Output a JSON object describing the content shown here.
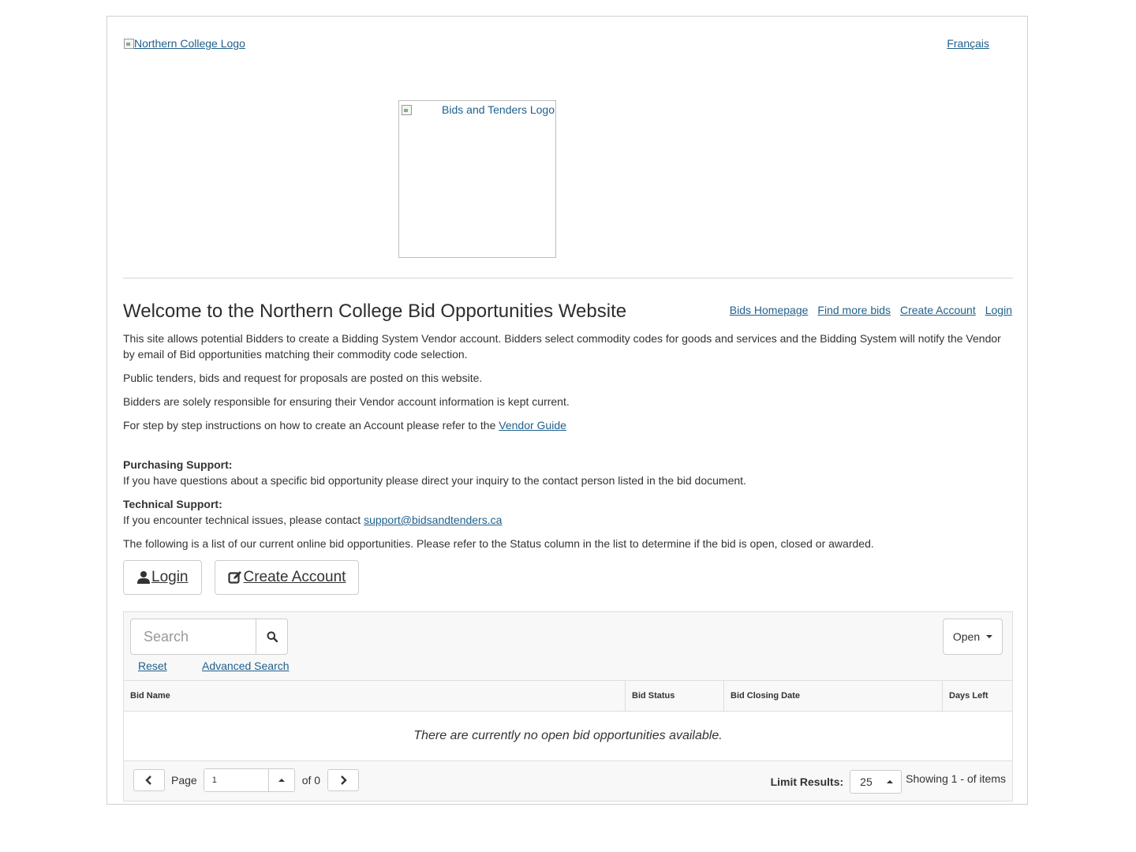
{
  "header": {
    "college_logo_alt": "Northern College Logo",
    "language_link": "Français",
    "tender_logo_alt": "Bids and Tenders Logo"
  },
  "welcome": {
    "title": "Welcome to the Northern College Bid Opportunities Website",
    "nav_links": [
      "Bids Homepage",
      "Find more bids",
      "Create Account",
      "Login"
    ]
  },
  "content": {
    "p1": "This site allows potential Bidders to create a Bidding System Vendor account.  Bidders select commodity codes for goods and services and the Bidding System will notify the Vendor by email of Bid opportunities matching their commodity code selection.",
    "p2": "Public tenders, bids and request for proposals are posted on this website.",
    "p3": "Bidders are solely responsible for ensuring their Vendor account information is kept current.",
    "p4_prefix": "For step by step instructions on how to create an Account please refer to the ",
    "p4_link": "Vendor Guide",
    "purchasing_heading": "Purchasing Support:",
    "purchasing_text": "If you have questions about a specific bid opportunity please direct your inquiry to the contact person listed in the bid document.",
    "technical_heading": "Technical Support:",
    "technical_prefix": "If you encounter technical issues, please contact ",
    "technical_email": "support@bidsandtenders.ca",
    "list_intro": "The following is a list of our current online bid opportunities. Please refer to the Status column in the list to determine if the bid is open, closed or awarded."
  },
  "actions": {
    "login_label": "Login",
    "create_account_label": "Create Account"
  },
  "search": {
    "placeholder": "Search",
    "reset_label": "Reset",
    "advanced_label": "Advanced Search",
    "status_filter": "Open"
  },
  "table": {
    "columns": [
      "Bid Name",
      "Bid Status",
      "Bid Closing Date",
      "Days Left"
    ],
    "empty_message": "There are currently no open bid opportunities available."
  },
  "pagination": {
    "page_label": "Page",
    "page_value": "1",
    "of_label": "of 0",
    "limit_label": "Limit Results:",
    "limit_value": "25",
    "showing": "Showing 1 - of items"
  },
  "colors": {
    "link": "#1f5f8b",
    "border": "#cccccc",
    "panel_bg": "#f8f8f8"
  }
}
